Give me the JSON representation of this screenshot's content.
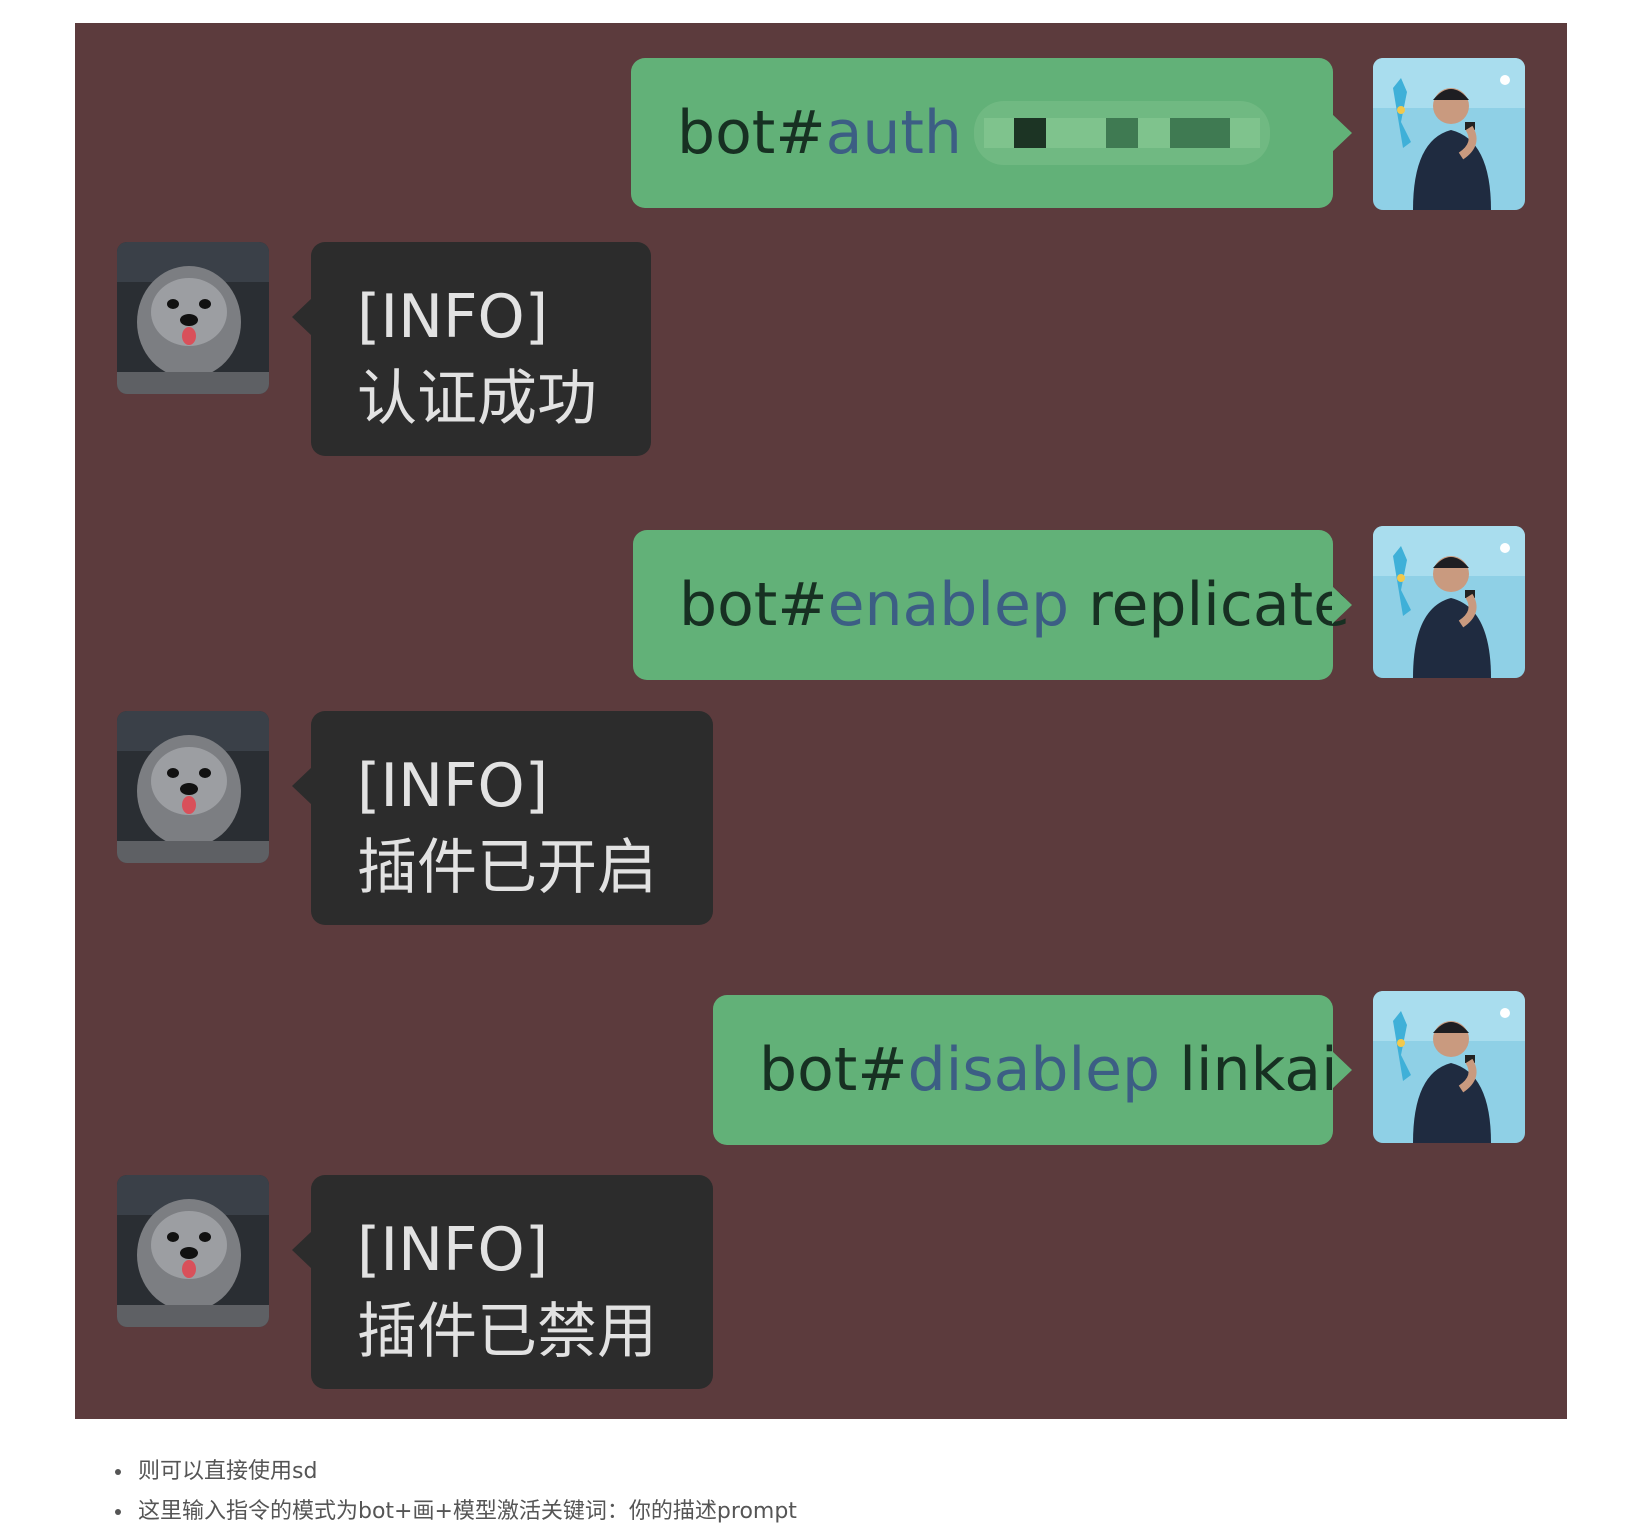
{
  "chat": {
    "background": "#5c3b3d",
    "outgoing_bubble_color": "#62b178",
    "incoming_bubble_color": "#2c2c2c",
    "messages": [
      {
        "side": "outgoing",
        "prefix": "bot#",
        "keyword": "auth",
        "argument": "",
        "redacted": true
      },
      {
        "side": "incoming",
        "line1": "[INFO]",
        "line2": "认证成功"
      },
      {
        "side": "outgoing",
        "prefix": "bot#",
        "keyword": "enablep",
        "argument": "replicate"
      },
      {
        "side": "incoming",
        "line1": "[INFO]",
        "line2": "插件已开启"
      },
      {
        "side": "outgoing",
        "prefix": "bot#",
        "keyword": "disablep",
        "argument": "linkai"
      },
      {
        "side": "incoming",
        "line1": "[INFO]",
        "line2": "插件已禁用"
      }
    ],
    "avatars": {
      "user": "speaker-photo-avatar",
      "bot": "dog-photo-avatar"
    }
  },
  "notes": [
    "则可以直接使用sd",
    "这里输入指令的模式为bot+画+模型激活关键词：你的描述prompt"
  ]
}
